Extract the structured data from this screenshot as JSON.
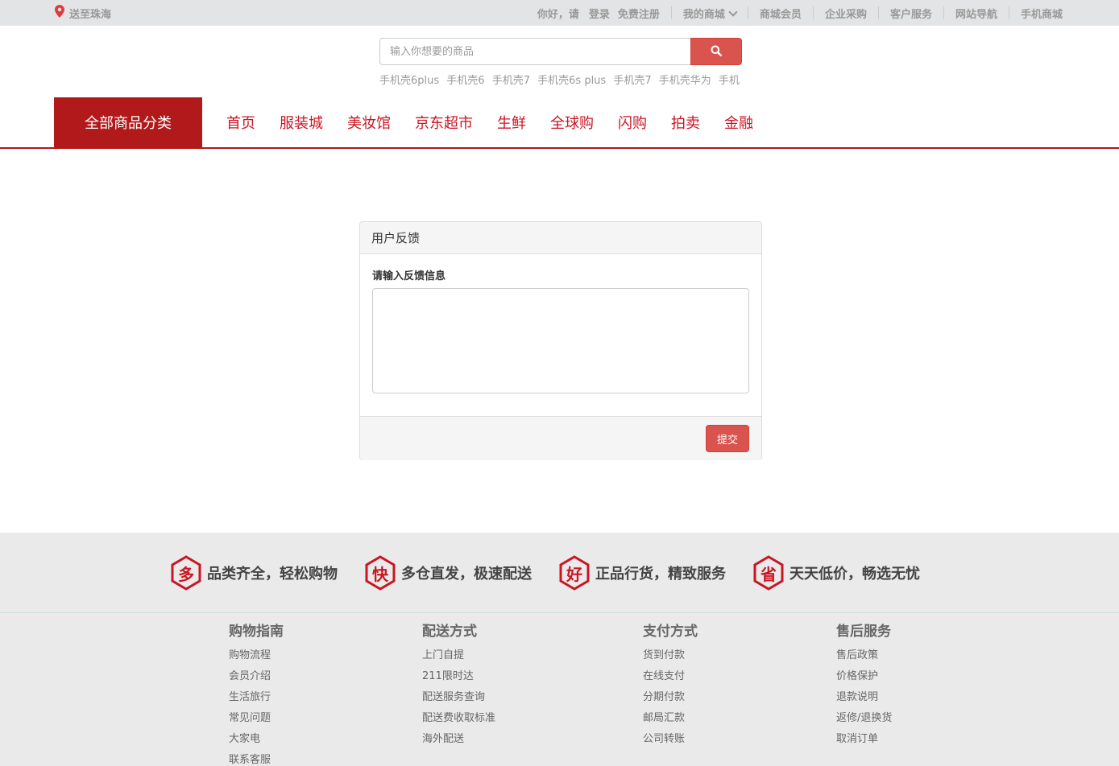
{
  "topbar": {
    "location": "送至珠海",
    "hello": "你好，请",
    "login": "登录",
    "register": "免费注册",
    "my_mall": "我的商城",
    "links": [
      "商城会员",
      "企业采购",
      "客户服务",
      "网站导航",
      "手机商城"
    ]
  },
  "search": {
    "placeholder": "输入你想要的商品",
    "hotwords": [
      "手机壳6plus",
      "手机壳6",
      "手机壳7",
      "手机壳6s plus",
      "手机壳7",
      "手机壳华为",
      "手机"
    ]
  },
  "mainnav": {
    "all_categories": "全部商品分类",
    "items": [
      "首页",
      "服装城",
      "美妆馆",
      "京东超市",
      "生鲜",
      "全球购",
      "闪购",
      "拍卖",
      "金融"
    ]
  },
  "feedback": {
    "title": "用户反馈",
    "label": "请输入反馈信息",
    "value": "",
    "submit": "提交"
  },
  "colors": {
    "brand_red": "#b1191a",
    "nav_text": "#c81623",
    "button_red": "#d9534f"
  },
  "footer": {
    "promises": [
      {
        "icon": "多",
        "text": "品类齐全，轻松购物"
      },
      {
        "icon": "快",
        "text": "多仓直发，极速配送"
      },
      {
        "icon": "好",
        "text": "正品行货，精致服务"
      },
      {
        "icon": "省",
        "text": "天天低价，畅选无忧"
      }
    ],
    "columns": [
      {
        "title": "购物指南",
        "items": [
          "购物流程",
          "会员介绍",
          "生活旅行",
          "常见问题",
          "大家电",
          "联系客服"
        ]
      },
      {
        "title": "配送方式",
        "items": [
          "上门自提",
          "211限时达",
          "配送服务查询",
          "配送费收取标准",
          "海外配送"
        ]
      },
      {
        "title": "支付方式",
        "items": [
          "货到付款",
          "在线支付",
          "分期付款",
          "邮局汇款",
          "公司转账"
        ]
      },
      {
        "title": "售后服务",
        "items": [
          "售后政策",
          "价格保护",
          "退款说明",
          "返修/退换货",
          "取消订单"
        ]
      }
    ]
  }
}
